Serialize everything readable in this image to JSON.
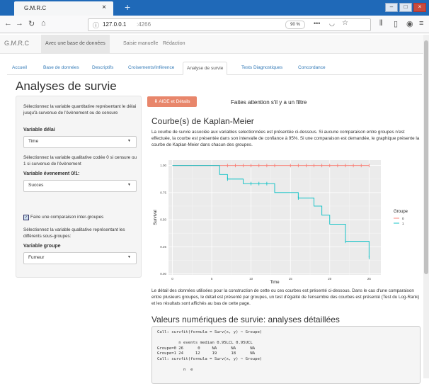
{
  "browser": {
    "tab_title": "G.M.R.C",
    "tab_close": "×",
    "new_tab": "+",
    "url_host": "127.0.0.1",
    "url_port": ":4266",
    "zoom": "90 %",
    "window_buttons": [
      "–",
      "□",
      "×"
    ]
  },
  "app_nav": {
    "brand": "G.M.R.C",
    "items": [
      "Avec une base de données",
      "Saisie manuelle",
      "Rédaction"
    ],
    "active_index": 0
  },
  "tabs": {
    "items": [
      "Accueil",
      "Base de données",
      "Descriptifs",
      "Croisements/Inférence",
      "Analyse de survie",
      "Tests Diagnostiques",
      "Concordance"
    ],
    "active_index": 4
  },
  "page_title": "Analyses de survie",
  "sidebar": {
    "text1": "Sélectionnez la variable quantitative représentant le délai jusqu'à survenue de l'évènement ou de censure",
    "label1": "Variable délai",
    "select1": "Time",
    "text2": "Sélectionnez la variable qualitative codée 0 si censure ou 1 si survenue de l'évènement",
    "label2": "Variable évenement 0/1:",
    "select2": "Succes",
    "checkbox_label": "Faire une comparaison inter-groupes",
    "text3": "Sélectionnez la variable qualitative représentant les différents sous-groupes:",
    "label3": "Variable groupe",
    "select3": "Fumeur"
  },
  "main": {
    "help_button": "AIDE et Détails",
    "warning": "Faites attention s'il y a un filtre",
    "km_title": "Courbe(s) de Kaplan-Meier",
    "km_desc": "La courbe de survie associée aux variables selectionnées est présentée ci-dessous. Si aucune comparaison entre groupes n'est effectuée, la courbe est présentée dans son intervalle de confiance à 95%. Si une comparaison est demandée, le graphique présente la courbe de Kaplan-Meier dans chacun des groupes.",
    "details_text": "Le détail des données utilisées pour la construction de cette ou ces courbes est présenté ci-dessous. Dans le cas d'une comparaison entre plusieurs groupes, le détail est présenté par groupes, un test d'égalité de l'ensemble des courbes est présenté (Test du Log-Rank) et les résultats sont affichés au bas de cette page.",
    "num_title": "Valeurs numériques de survie: analyses détaillées",
    "code_output": "Call: survfit(formula = Surv(x, y) ~ Groupe)\n\n         n events median 0.95LCL 0.95UCL\nGroupe=0 26      0     NA      NA      NA\nGroupe=1 24     12     19      18      NA\nCall: survfit(formula = Surv(x, y) ~ Groupe)\n\n           n  e"
  },
  "chart_data": {
    "type": "line",
    "xlabel": "Time",
    "ylabel": "Survival",
    "xlim": [
      -0.5,
      26.5
    ],
    "ylim": [
      -0.01,
      1.05
    ],
    "x_ticks": [
      0,
      5,
      10,
      15,
      20,
      25
    ],
    "y_ticks": [
      "0.00",
      "0.25",
      "0.50",
      "0.75",
      "1.00"
    ],
    "legend_title": "Groupe",
    "legend_position": "right",
    "grid": true,
    "series": [
      {
        "name": "0",
        "color": "#f8766d",
        "steps": [
          [
            0,
            1.0
          ],
          [
            25,
            1.0
          ]
        ],
        "censor_x": [
          7,
          8,
          9,
          10,
          11,
          12,
          13,
          15,
          16,
          17,
          18,
          19,
          20,
          21,
          22,
          23,
          24,
          25
        ]
      },
      {
        "name": "1",
        "color": "#00bfc4",
        "steps": [
          [
            0,
            1.0
          ],
          [
            6,
            0.917
          ],
          [
            7,
            0.875
          ],
          [
            9,
            0.833
          ],
          [
            10,
            0.833
          ],
          [
            13,
            0.75
          ],
          [
            16,
            0.7
          ],
          [
            18,
            0.625
          ],
          [
            19,
            0.542
          ],
          [
            20,
            0.458
          ],
          [
            22,
            0.3
          ],
          [
            25,
            0.15
          ]
        ],
        "censor_x": [
          7,
          10,
          11,
          12,
          16,
          22,
          25
        ]
      }
    ]
  }
}
